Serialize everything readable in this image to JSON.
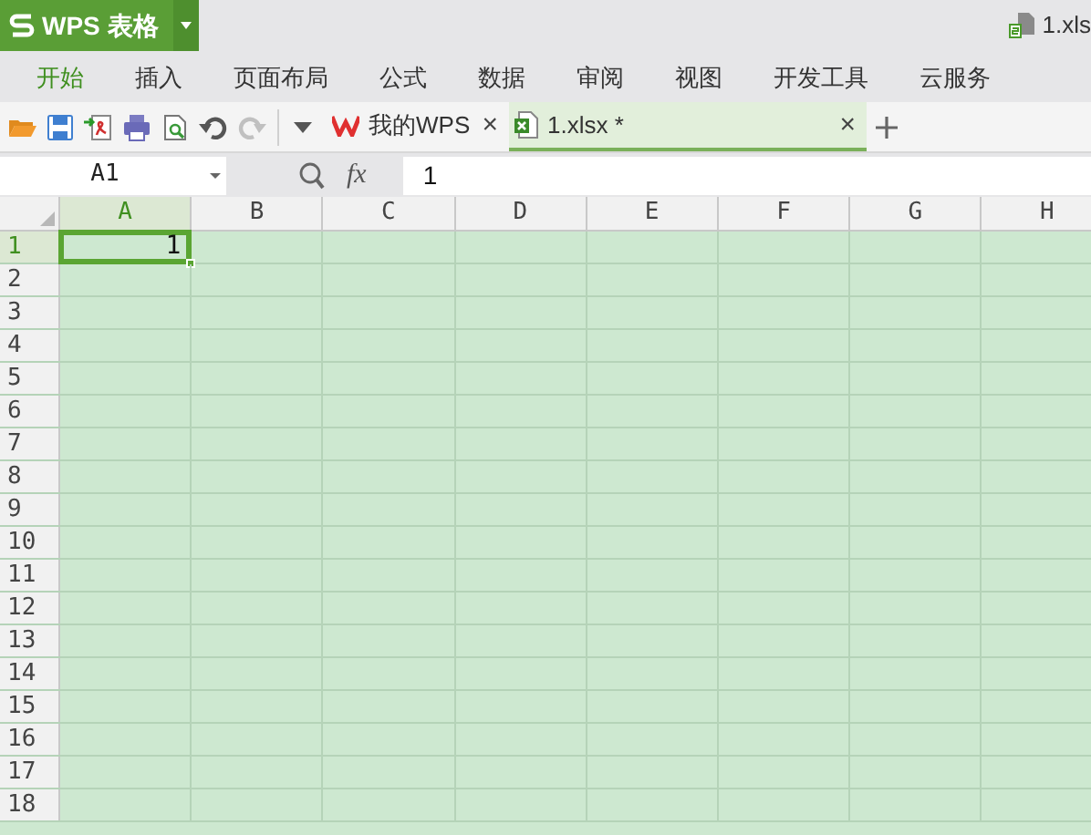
{
  "app_button": {
    "label": "WPS 表格"
  },
  "title": "1.xls",
  "menu": [
    {
      "label": "开始",
      "selected": true
    },
    {
      "label": "插入",
      "selected": false
    },
    {
      "label": "页面布局",
      "selected": false
    },
    {
      "label": "公式",
      "selected": false
    },
    {
      "label": "数据",
      "selected": false
    },
    {
      "label": "审阅",
      "selected": false
    },
    {
      "label": "视图",
      "selected": false
    },
    {
      "label": "开发工具",
      "selected": false
    },
    {
      "label": "云服务",
      "selected": false
    }
  ],
  "toolbar": {
    "redo_disabled": true
  },
  "tabs": [
    {
      "kind": "wps",
      "label": "我的WPS",
      "selected": false,
      "close": "×"
    },
    {
      "kind": "sheet",
      "label": "1.xlsx *",
      "selected": true,
      "close": "×"
    }
  ],
  "formula_bar": {
    "name_box": "A1",
    "fx": "fx",
    "value": "1"
  },
  "sheet": {
    "columns": [
      {
        "label": "A",
        "selected": true
      },
      {
        "label": "B",
        "selected": false
      },
      {
        "label": "C",
        "selected": false
      },
      {
        "label": "D",
        "selected": false
      },
      {
        "label": "E",
        "selected": false
      },
      {
        "label": "F",
        "selected": false
      },
      {
        "label": "G",
        "selected": false
      },
      {
        "label": "H",
        "selected": false
      }
    ],
    "rows": [
      {
        "label": "1",
        "selected": true,
        "cells": {
          "A": "1"
        }
      },
      {
        "label": "2",
        "selected": false
      },
      {
        "label": "3",
        "selected": false
      },
      {
        "label": "4",
        "selected": false
      },
      {
        "label": "5",
        "selected": false
      },
      {
        "label": "6",
        "selected": false
      },
      {
        "label": "7",
        "selected": false
      },
      {
        "label": "8",
        "selected": false
      },
      {
        "label": "9",
        "selected": false
      },
      {
        "label": "10",
        "selected": false
      },
      {
        "label": "11",
        "selected": false
      },
      {
        "label": "12",
        "selected": false
      },
      {
        "label": "13",
        "selected": false
      },
      {
        "label": "14",
        "selected": false
      },
      {
        "label": "15",
        "selected": false
      },
      {
        "label": "16",
        "selected": false
      },
      {
        "label": "17",
        "selected": false
      },
      {
        "label": "18",
        "selected": false
      }
    ]
  }
}
